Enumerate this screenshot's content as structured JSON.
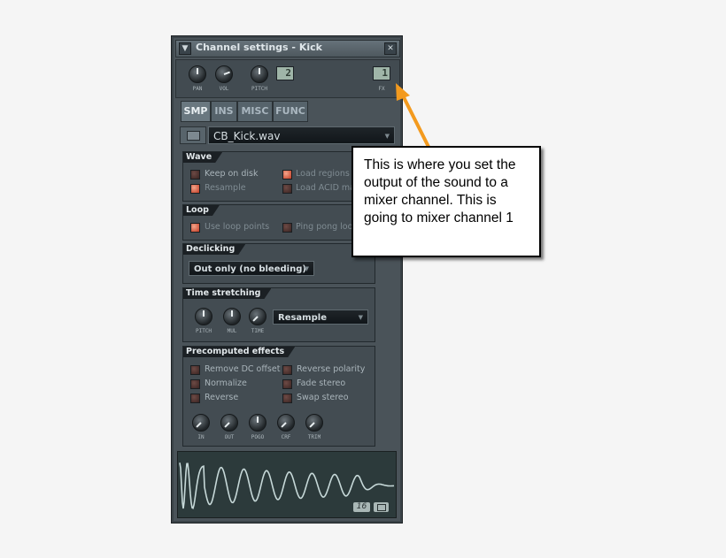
{
  "window": {
    "title": "Channel settings - Kick",
    "menu_icon": "triangle-down-icon",
    "close_icon": "close-icon"
  },
  "top": {
    "knobs": [
      {
        "label": "PAN",
        "value": 0
      },
      {
        "label": "VOL",
        "value": 0.78
      },
      {
        "label": "PITCH",
        "value": 0
      }
    ],
    "pitch_range": "2",
    "fx_label": "FX",
    "fx_value": "1"
  },
  "tabs": [
    {
      "label": "SMP",
      "active": true
    },
    {
      "label": "INS"
    },
    {
      "label": "MISC"
    },
    {
      "label": "FUNC"
    }
  ],
  "file": {
    "name": "CB_Kick.wav",
    "folder_icon": "folder-icon"
  },
  "wave": {
    "title": "Wave",
    "options": [
      {
        "label": "Keep on disk",
        "checked": false
      },
      {
        "label": "Load regions",
        "checked": true
      },
      {
        "label": "Resample",
        "checked": true
      },
      {
        "label": "Load ACID markers",
        "checked": false
      }
    ]
  },
  "loop": {
    "title": "Loop",
    "options": [
      {
        "label": "Use loop points",
        "checked": true
      },
      {
        "label": "Ping pong loop",
        "checked": false
      }
    ]
  },
  "declicking": {
    "title": "Declicking",
    "value": "Out only (no bleeding)"
  },
  "timestretch": {
    "title": "Time stretching",
    "knobs": [
      {
        "label": "PITCH"
      },
      {
        "label": "MUL"
      },
      {
        "label": "TIME"
      }
    ],
    "mode": "Resample"
  },
  "precomputed": {
    "title": "Precomputed effects",
    "options": [
      {
        "label": "Remove DC offset",
        "checked": false
      },
      {
        "label": "Reverse polarity",
        "checked": false
      },
      {
        "label": "Normalize",
        "checked": false
      },
      {
        "label": "Fade stereo",
        "checked": false
      },
      {
        "label": "Reverse",
        "checked": false
      },
      {
        "label": "Swap stereo",
        "checked": false
      }
    ],
    "knobs": [
      {
        "label": "IN"
      },
      {
        "label": "OUT"
      },
      {
        "label": "POGO"
      },
      {
        "label": "CRF"
      },
      {
        "label": "TRIM"
      }
    ]
  },
  "waveform": {
    "bits": "16",
    "clipboard_icon": "clipboard-icon"
  },
  "callout": {
    "text": "This is where you set the output of the sound to a mixer channel. This is going to mixer channel 1",
    "arrow_color": "#f39a1e"
  }
}
